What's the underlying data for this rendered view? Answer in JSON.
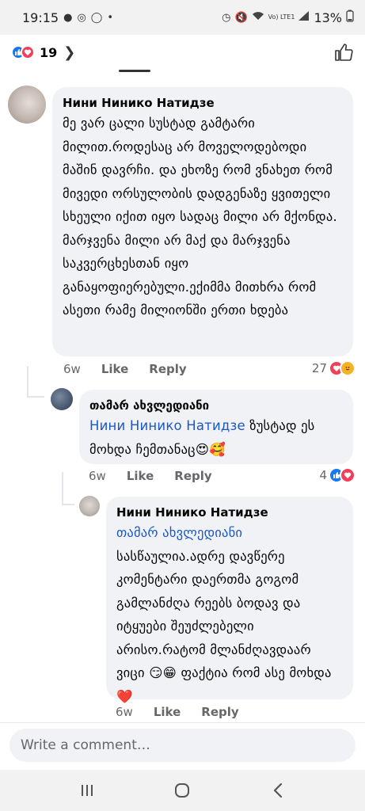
{
  "status_bar": {
    "time": "19:15",
    "network_label": "Vo) LTE1",
    "battery": "13%"
  },
  "reactions_header": {
    "count": "19",
    "icons": [
      "like-icon",
      "love-icon"
    ]
  },
  "comments": [
    {
      "author": "Нини Нинико Натидзе",
      "text": "მე ვარ ცალი სუსტად გამტარი მილით.როდესაც არ მოველოდებოდი მაშინ დავრჩი. და ეხოზე რომ ვნახეთ რომ მივედი ორსულობის დადგენაზე ყვითელი სხეული იქით იყო სადაც მილი არ მქონდა. მარჯვენა მილი არ მაქ და მარჯვენა საკვერცხესთან იყო განაყოფიერებული.ექიმმა მითხრა რომ ასეთი რამე  მილიონში ერთი ხდება",
      "time": "6w",
      "like": "Like",
      "reply": "Reply",
      "reaction_count": "27"
    },
    {
      "author": "თამარ ახვლედიანი",
      "mention": "Нини Нинико Натидзе",
      "text": " ზუსტად ეს მოხდა ჩემთანაც",
      "emoji": "😍🥰",
      "time": "6w",
      "like": "Like",
      "reply": "Reply",
      "reaction_count": "4"
    },
    {
      "author": "Нини Нинико Натидзе",
      "mention": "თამარ ახვლედიანი",
      "text": "სასწაულია.ადრე დავწერე კომენტარი დაერთმა გოგომ გამლანძღა რეებს ბოდავ და იტყუები შეუძლებელი არისო.რატომ მლანძღავდაარ ვიცი 😏😁 ფაქტია რომ ასე მოხდა",
      "emoji": "❤️",
      "time": "6w",
      "like": "Like",
      "reply": "Reply"
    }
  ],
  "composer": {
    "placeholder": "Write a comment…"
  },
  "colors": {
    "like_blue": "#1877f2",
    "love_red": "#f33e58",
    "mention_blue": "#1a57c9",
    "bubble_bg": "#f0f2f5"
  }
}
